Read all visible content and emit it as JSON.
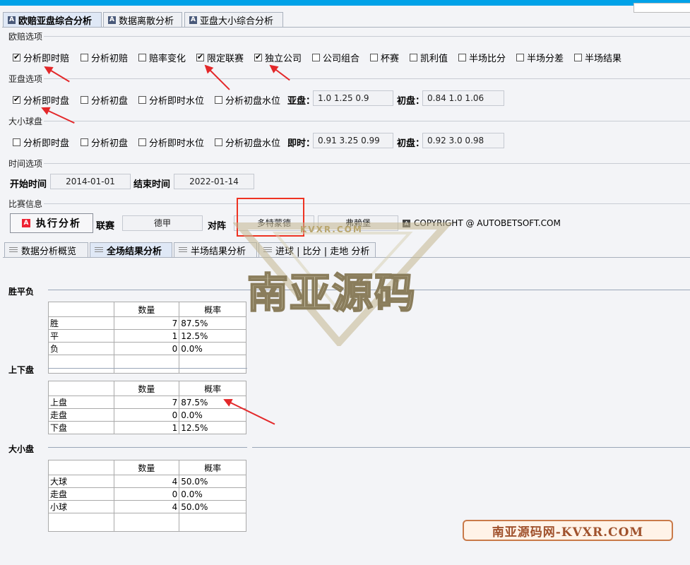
{
  "top_tabs": [
    {
      "label": "欧赔亚盘综合分析",
      "active": true
    },
    {
      "label": "数据离散分析",
      "active": false
    },
    {
      "label": "亚盘大小综合分析",
      "active": false
    }
  ],
  "euro_section": {
    "title": "欧赔选项",
    "options": [
      {
        "label": "分析即时赔",
        "checked": true
      },
      {
        "label": "分析初赔",
        "checked": false
      },
      {
        "label": "赔率变化",
        "checked": false
      },
      {
        "label": "限定联赛",
        "checked": true
      },
      {
        "label": "独立公司",
        "checked": true
      },
      {
        "label": "公司组合",
        "checked": false
      },
      {
        "label": "杯赛",
        "checked": false
      },
      {
        "label": "凯利值",
        "checked": false
      },
      {
        "label": "半场比分",
        "checked": false
      },
      {
        "label": "半场分差",
        "checked": false
      },
      {
        "label": "半场结果",
        "checked": false
      }
    ]
  },
  "asian_section": {
    "title": "亚盘选项",
    "options": [
      {
        "label": "分析即时盘",
        "checked": true
      },
      {
        "label": "分析初盘",
        "checked": false
      },
      {
        "label": "分析即时水位",
        "checked": false
      },
      {
        "label": "分析初盘水位",
        "checked": false
      }
    ],
    "current_label": "亚盘：",
    "current_value": "1.0  1.25  0.9",
    "initial_label": "初盘：",
    "initial_value": "0.84  1.0  1.06"
  },
  "ou_section": {
    "title": "大小球盘",
    "options": [
      {
        "label": "分析即时盘",
        "checked": false
      },
      {
        "label": "分析初盘",
        "checked": false
      },
      {
        "label": "分析即时水位",
        "checked": false
      },
      {
        "label": "分析初盘水位",
        "checked": false
      }
    ],
    "current_label": "即时：",
    "current_value": "0.91  3.25  0.99",
    "initial_label": "初盘：",
    "initial_value": "0.92  3.0  0.98"
  },
  "time_section": {
    "title": "时间选项",
    "start_label": "开始时间",
    "start_value": "2014-01-01",
    "end_label": "结束时间",
    "end_value": "2022-01-14"
  },
  "match_section": {
    "title": "比赛信息",
    "run_button": "执行分析",
    "league_label": "联赛",
    "league_value": "德甲",
    "vs_label": "对阵",
    "home_team": "多特蒙德",
    "away_team": "弗赖堡",
    "copyright": "COPYRIGHT @ AUTOBETSOFT.COM"
  },
  "result_tabs": [
    {
      "label": "数据分析概览",
      "active": false
    },
    {
      "label": "全场结果分析",
      "active": true
    },
    {
      "label": "半场结果分析",
      "active": false
    },
    {
      "label": "进球 | 比分 | 走地 分析",
      "active": false
    }
  ],
  "groups": [
    {
      "title": "胜平负",
      "headers": [
        "",
        "数量",
        "概率"
      ],
      "rows": [
        [
          "胜",
          "7",
          "87.5%"
        ],
        [
          "平",
          "1",
          "12.5%"
        ],
        [
          "负",
          "0",
          "0.0%"
        ]
      ]
    },
    {
      "title": "上下盘",
      "headers": [
        "",
        "数量",
        "概率"
      ],
      "rows": [
        [
          "上盘",
          "7",
          "87.5%"
        ],
        [
          "走盘",
          "0",
          "0.0%"
        ],
        [
          "下盘",
          "1",
          "12.5%"
        ]
      ]
    },
    {
      "title": "大小盘",
      "headers": [
        "",
        "数量",
        "概率"
      ],
      "rows": [
        [
          "大球",
          "4",
          "50.0%"
        ],
        [
          "走盘",
          "0",
          "0.0%"
        ],
        [
          "小球",
          "4",
          "50.0%"
        ]
      ]
    }
  ],
  "watermark": {
    "main": "南亚源码",
    "small": "KVXR.COM",
    "stamp": "南亚源码网-KVXR.COM"
  },
  "colors": {
    "accent_blue": "#00a2e8",
    "annotation_red": "#e3282a"
  }
}
